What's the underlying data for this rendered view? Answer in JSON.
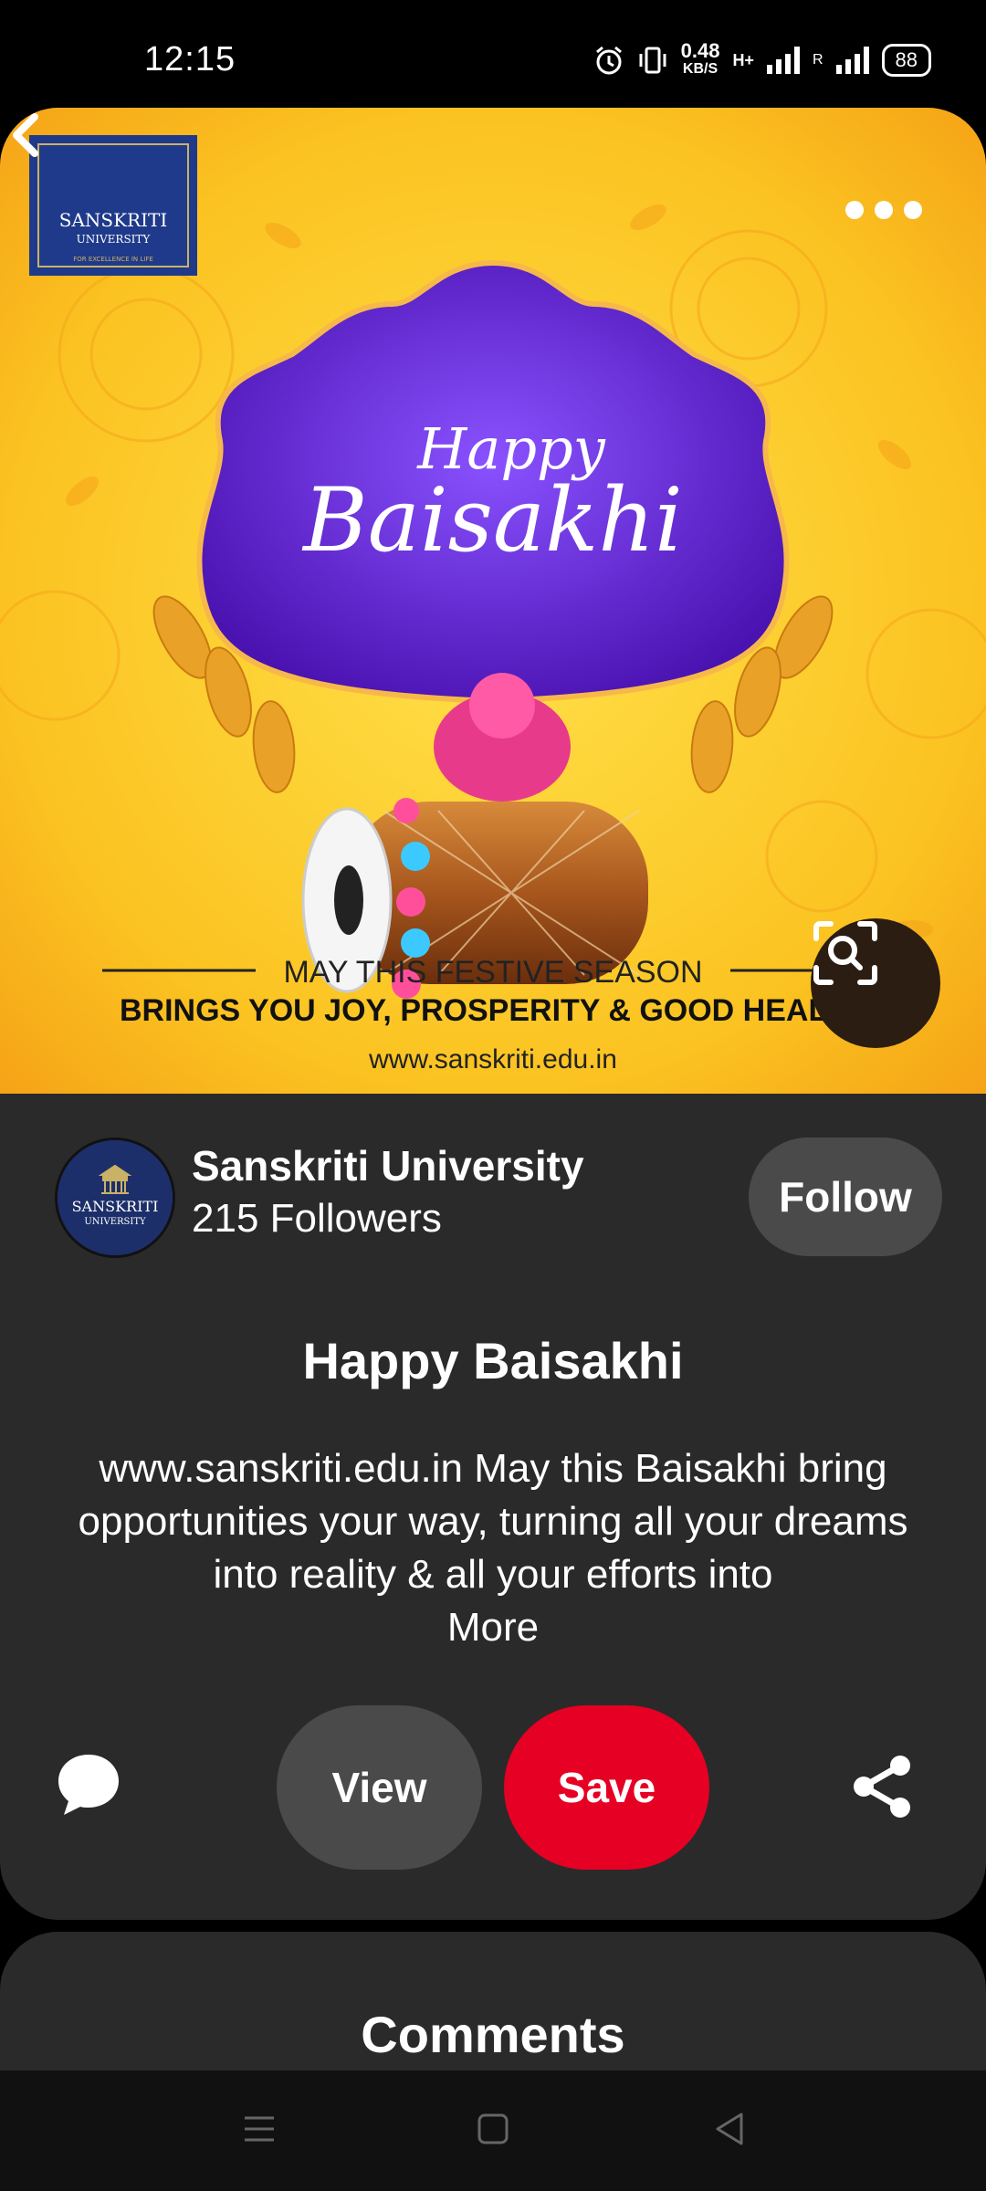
{
  "status_bar": {
    "time": "12:15",
    "speed_value": "0.48",
    "speed_unit": "KB/S",
    "network": "H+",
    "roaming": "R",
    "battery": "88",
    "icons": [
      "alarm-icon",
      "vibrate-icon",
      "signal-icon",
      "signal-icon",
      "battery-icon"
    ]
  },
  "hero": {
    "logo_text": "SANSKRITI",
    "logo_sub": "UNIVERSITY",
    "logo_motto": "FOR EXCELLENCE IN LIFE",
    "headline_1": "Happy",
    "headline_2": "Baisakhi",
    "tagline_1": "MAY THIS FESTIVE SEASON",
    "tagline_2": "BRINGS YOU JOY, PROSPERITY & GOOD HEALTH",
    "website": "www.sanskriti.edu.in"
  },
  "profile": {
    "name": "Sanskriti University",
    "followers": "215 Followers",
    "follow_label": "Follow"
  },
  "pin": {
    "title": "Happy Baisakhi",
    "description": "www.sanskriti.edu.in  May this Baisakhi bring opportunities your way, turning all your dreams into reality & all your efforts into",
    "more_label": "More"
  },
  "actions": {
    "view_label": "View",
    "save_label": "Save"
  },
  "comments": {
    "title": "Comments"
  },
  "colors": {
    "card_bg": "#2a2a2a",
    "save_red": "#e60023",
    "button_gray": "#4a4a4a",
    "hero_yellow": "#fbc321",
    "badge_purple": "#5a20c8"
  }
}
